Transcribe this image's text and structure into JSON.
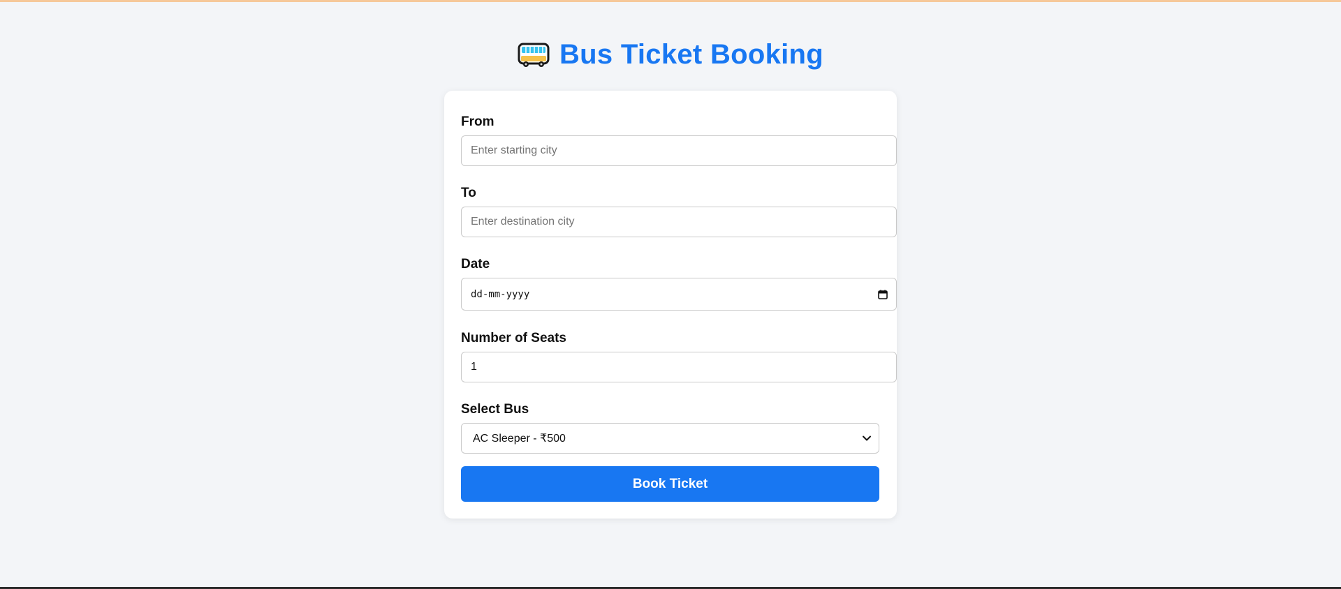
{
  "page": {
    "title": "Bus Ticket Booking",
    "icon": "bus-icon"
  },
  "form": {
    "from": {
      "label": "From",
      "placeholder": "Enter starting city",
      "value": ""
    },
    "to": {
      "label": "To",
      "placeholder": "Enter destination city",
      "value": ""
    },
    "date": {
      "label": "Date",
      "placeholder": "dd-mm-yyyy",
      "icon": "calendar-icon"
    },
    "seats": {
      "label": "Number of Seats",
      "value": "1"
    },
    "bus": {
      "label": "Select Bus",
      "selected": "AC Sleeper - ₹500",
      "icon": "chevron-down-icon"
    },
    "submit_label": "Book Ticket"
  },
  "colors": {
    "accent": "#1877f2",
    "background": "#f3f5f8",
    "card": "#ffffff",
    "top_border": "#f6c89a"
  }
}
